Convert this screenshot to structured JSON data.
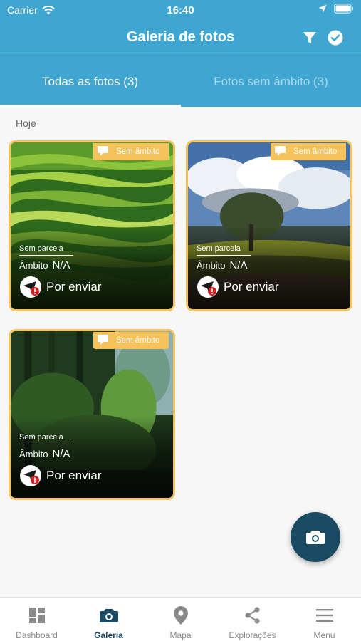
{
  "status_bar": {
    "carrier": "Carrier",
    "time": "16:40",
    "icons": [
      "wifi-icon",
      "location-arrow-icon",
      "battery-icon"
    ]
  },
  "app_bar": {
    "title": "Galeria de fotos",
    "actions": [
      "filter-icon",
      "check-circle-icon"
    ]
  },
  "tabs": [
    {
      "label": "Todas as fotos (3)",
      "active": true
    },
    {
      "label": "Fotos sem âmbito (3)",
      "active": false
    }
  ],
  "section": {
    "label": "Hoje"
  },
  "photos": [
    {
      "scene": "terraced-rice-fields",
      "badge": "Sem âmbito",
      "parcel": "Sem parcela",
      "ambito_label": "Âmbito",
      "ambito_value": "N/A",
      "status": "Por enviar"
    },
    {
      "scene": "lone-tree-cloudy-sky",
      "badge": "Sem âmbito",
      "parcel": "Sem parcela",
      "ambito_label": "Âmbito",
      "ambito_value": "N/A",
      "status": "Por enviar"
    },
    {
      "scene": "green-forest",
      "badge": "Sem âmbito",
      "parcel": "Sem parcela",
      "ambito_label": "Âmbito",
      "ambito_value": "N/A",
      "status": "Por enviar"
    }
  ],
  "fab": {
    "icon": "camera-icon"
  },
  "bottom_nav": [
    {
      "label": "Dashboard",
      "icon": "dashboard-grid-icon",
      "active": false
    },
    {
      "label": "Galeria",
      "icon": "camera-icon",
      "active": true
    },
    {
      "label": "Mapa",
      "icon": "map-pin-icon",
      "active": false
    },
    {
      "label": "Explorações",
      "icon": "share-nodes-icon",
      "active": false
    },
    {
      "label": "Menu",
      "icon": "hamburger-menu-icon",
      "active": false
    }
  ],
  "colors": {
    "primary": "#3ea6d1",
    "dark_accent": "#1b4a63",
    "badge": "#f5c25c",
    "warning": "#d42020"
  }
}
